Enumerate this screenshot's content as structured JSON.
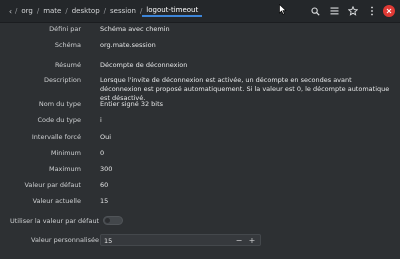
{
  "breadcrumb": {
    "back_icon": "chevron-left-icon",
    "segments": [
      "org",
      "mate",
      "desktop",
      "session",
      "logout-timeout"
    ]
  },
  "header_icons": [
    "search-icon",
    "menu-icon",
    "star-icon",
    "more-icon",
    "close-icon"
  ],
  "details": {
    "defined_by": {
      "label": "Défini par",
      "value": "Schéma avec chemin"
    },
    "schema": {
      "label": "Schéma",
      "value": "org.mate.session"
    },
    "summary": {
      "label": "Résumé",
      "value": "Décompte de déconnexion"
    },
    "description": {
      "label": "Description",
      "value": "Lorsque l'invite de déconnexion est activée, un décompte en secondes avant déconnexion est proposé automatiquement. Si la valeur est 0, le décompte automatique est désactivé."
    },
    "type_name": {
      "label": "Nom du type",
      "value": "Entier signé 32 bits"
    },
    "type_code": {
      "label": "Code du type",
      "value": "i"
    },
    "forced_range": {
      "label": "Intervalle forcé",
      "value": "Oui"
    },
    "minimum": {
      "label": "Minimum",
      "value": "0"
    },
    "maximum": {
      "label": "Maximum",
      "value": "300"
    },
    "default_value": {
      "label": "Valeur par défaut",
      "value": "60"
    },
    "current_value": {
      "label": "Valeur actuelle",
      "value": "15"
    }
  },
  "use_default": {
    "label": "Utiliser la valeur par défaut",
    "enabled": false
  },
  "custom_value": {
    "label": "Valeur personnalisée",
    "value": "15",
    "minus": "−",
    "plus": "+"
  },
  "colors": {
    "accent": "#3d85d8",
    "close": "#e03a35",
    "background": "#2d3033"
  }
}
